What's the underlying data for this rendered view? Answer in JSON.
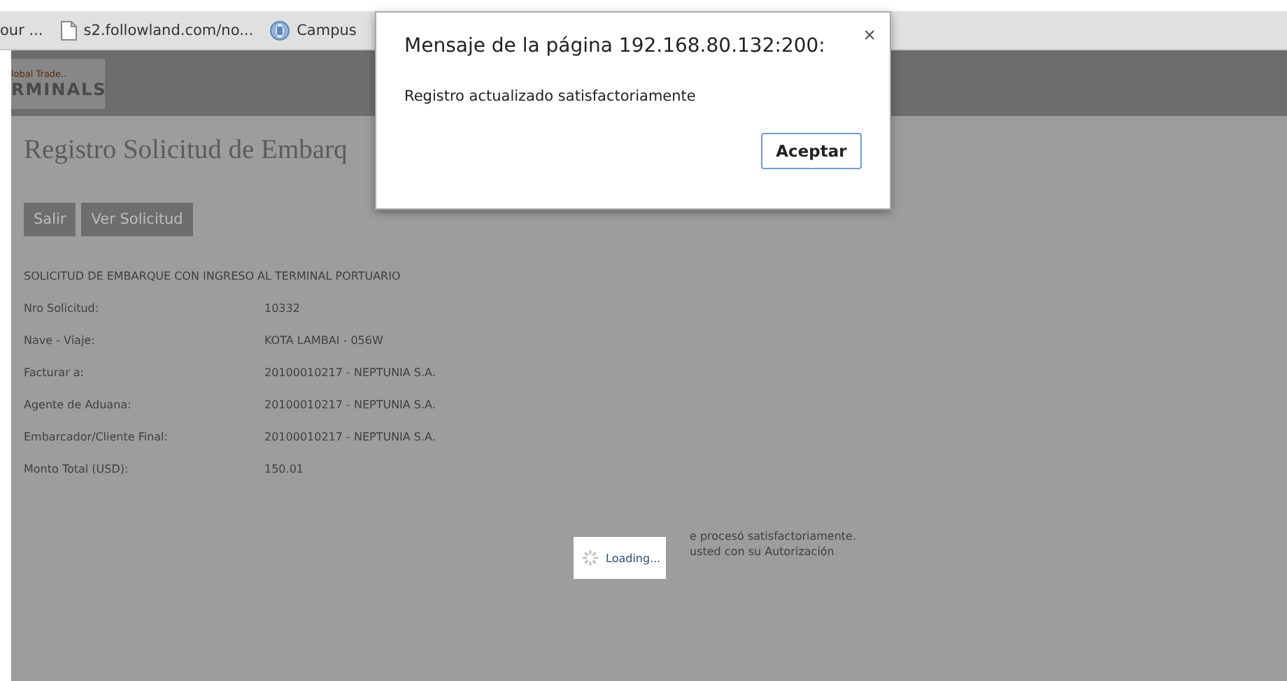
{
  "bookmarks": [
    {
      "label": "our ...",
      "kind": "plain"
    },
    {
      "label": "s2.followland.com/no...",
      "kind": "page"
    },
    {
      "label": "Campus",
      "kind": "globe"
    }
  ],
  "logo": {
    "tagline": "lobal Trade..",
    "name": "RMINALS"
  },
  "page": {
    "title": "Registro Solicitud de Embarq",
    "buttons": [
      "Salir",
      "Ver Solicitud"
    ],
    "section": "SOLICITUD DE EMBARQUE CON INGRESO AL TERMINAL PORTUARIO",
    "fields": [
      {
        "label": "Nro Solicitud:",
        "value": "10332"
      },
      {
        "label": "Nave - Viaje:",
        "value": "KOTA LAMBAI - 056W"
      },
      {
        "label": "Facturar a:",
        "value": "20100010217 - NEPTUNIA S.A."
      },
      {
        "label": "Agente de Aduana:",
        "value": "20100010217 - NEPTUNIA S.A."
      },
      {
        "label": "Embarcador/Cliente Final:",
        "value": "20100010217 - NEPTUNIA S.A."
      },
      {
        "label": "Monto Total (USD):",
        "value": "150.01"
      }
    ],
    "notes": [
      "e procesó satisfactoriamente.",
      "usted con su Autorización"
    ]
  },
  "loading": {
    "text": "Loading..."
  },
  "dialog": {
    "title": "Mensaje de la página 192.168.80.132:200:",
    "close": "×",
    "message": "Registro actualizado satisfactoriamente",
    "button": "Aceptar"
  }
}
